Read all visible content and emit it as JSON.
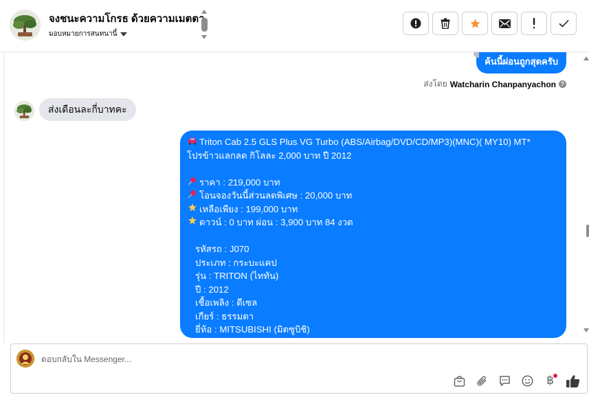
{
  "header": {
    "title": "จงชนะความโกรธ ด้วยความเมตตา",
    "assign_label": "มอบหมายการสนทนานี้"
  },
  "actions": [
    {
      "name": "report-icon"
    },
    {
      "name": "trash-icon"
    },
    {
      "name": "star-icon"
    },
    {
      "name": "envelope-icon"
    },
    {
      "name": "exclamation-icon"
    },
    {
      "name": "checkmark-icon"
    }
  ],
  "conversation": {
    "outgoing_top": "ค้นนี้ผ่อนถูกสุดครับ",
    "sent_by_prefix": "ส่งโดย",
    "sent_by_name": "Watcharin Chanpanyachon",
    "incoming": "ส่งเดือนละกี่บาทคะ",
    "listing": {
      "title_line1": "Triton Cab 2.5 GLS Plus VG Turbo (ABS/Airbag/DVD/CD/MP3)(MNC)( MY10) MT*",
      "title_line2": "โปรข้าวแลกลด กิโลละ 2,000 บาท ปี 2012",
      "price": "ราคา : 219,000 บาท",
      "discount": "โอนจองวันนี้ส่วนลดพิเศษ : 20,000 บาท",
      "remaining": "เหลือเพียง : 199,000 บาท",
      "down": "ดาวน์ : 0 บาท ผ่อน : 3,900 บาท 84 งวด",
      "code": "รหัสรถ : J070",
      "type": "ประเภท : กระบะแคป",
      "model": "รุ่น : TRITON (ไททัน)",
      "year": "ปี : 2012",
      "fuel": "เชื้อเพลิง : ดีเซล",
      "gear": "เกียร์ : ธรรมดา",
      "brand": "ยี่ห้อ : MITSUBISHI (มิตซูบิชิ)"
    }
  },
  "composer": {
    "placeholder": "ตอบกลับใน Messenger...",
    "tools": [
      "bag-icon",
      "paperclip-icon",
      "saved-reply-icon",
      "emoji-icon",
      "baht-icon",
      "thumbs-up-icon"
    ]
  },
  "colors": {
    "accent": "#0a7cff",
    "incoming_bubble": "#e4e6eb",
    "star": "#f7923a"
  }
}
